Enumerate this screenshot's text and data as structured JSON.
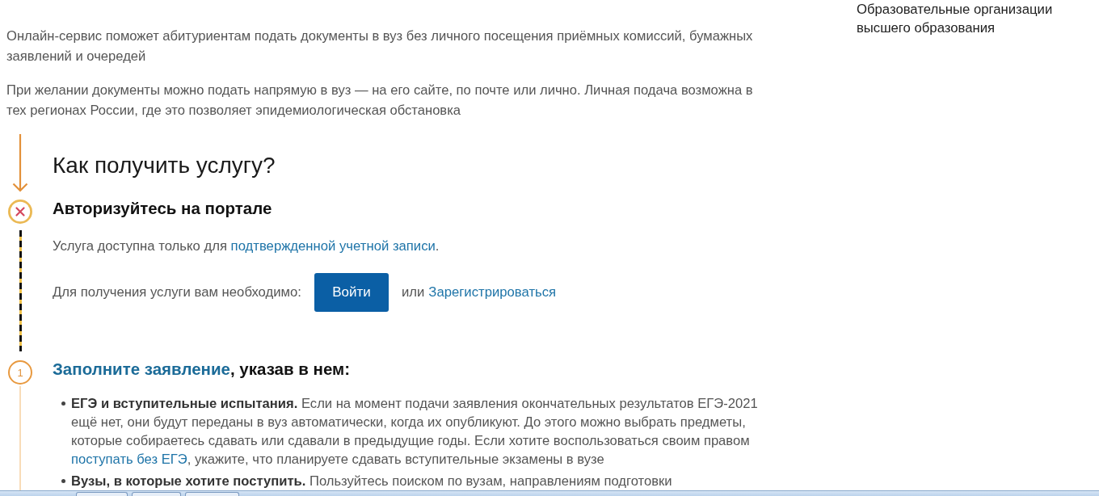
{
  "intro": [
    "Онлайн-сервис поможет абитуриентам подать документы в вуз без личного посещения приёмных комиссий, бумажных заявлений и очередей",
    "При желании документы можно подать напрямую в вуз — на его сайте, по почте или лично. Личная подача возможна в тех регионах России, где это позволяет эпидемиологическая обстановка"
  ],
  "sidebar": {
    "text": "Образовательные организации высшего образования"
  },
  "how_to": {
    "title": "Как получить услугу?",
    "steps": [
      {
        "kind": "cross",
        "title": [
          {
            "kind": "text",
            "text": "Авторизуйтесь на портале"
          }
        ],
        "note": [
          {
            "kind": "text",
            "text": "Услуга доступна только для "
          },
          {
            "kind": "link",
            "text": "подтвержденной учетной записи"
          },
          {
            "kind": "text",
            "text": "."
          }
        ],
        "login": {
          "label": "Для получения услуги вам необходимо:",
          "button": "Войти",
          "or": "или",
          "register_link": "Зарегистрироваться"
        }
      },
      {
        "kind": "numbered",
        "number": "1",
        "title": [
          {
            "kind": "link",
            "text": "Заполните заявление"
          },
          {
            "kind": "text",
            "text": ", указав в нем:"
          }
        ],
        "items": [
          {
            "parts": [
              {
                "kind": "text",
                "text": "**ЕГЭ и вступительные испытания.** Если на момент подачи заявления окончательных результатов ЕГЭ-2021 ещё нет, они будут переданы в вуз автоматически, когда их опубликуют. До этого можно выбрать предметы, которые собираетесь сдавать или сдавали в предыдущие годы. Если хотите воспользоваться своим правом "
              },
              {
                "kind": "link",
                "text": "поступать без ЕГЭ"
              },
              {
                "kind": "text",
                "text": ", укажите, что планируете сдавать вступительные экзамены в вузе"
              }
            ]
          },
          {
            "parts": [
              {
                "kind": "text",
                "text": "**Вузы, в которые хотите поступить.** Пользуйтесь поиском по вузам, направлениям подготовки"
              }
            ]
          }
        ]
      }
    ]
  }
}
